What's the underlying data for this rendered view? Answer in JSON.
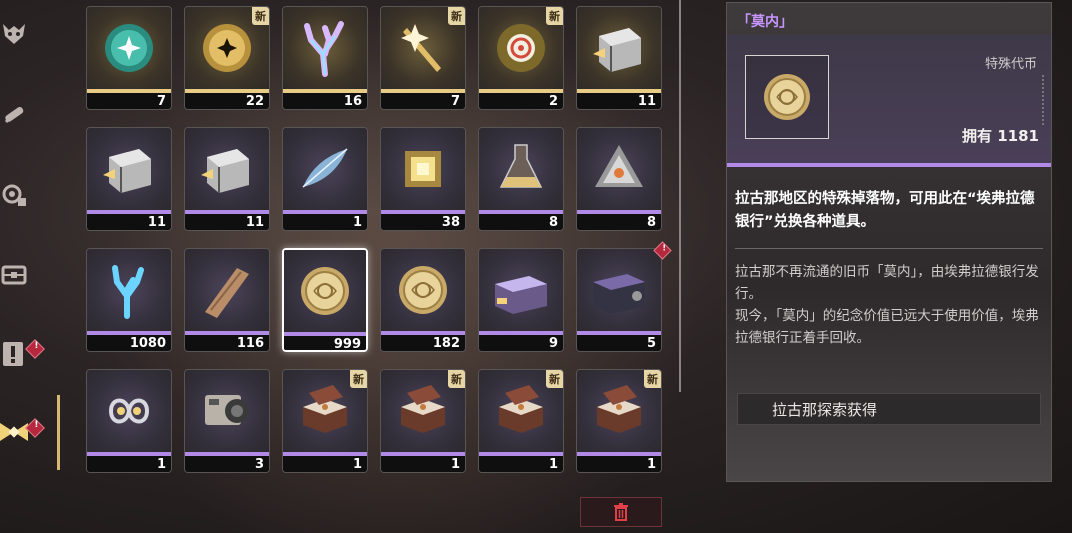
{
  "colors": {
    "gold": "#e8cb85",
    "purple": "#b18ae8",
    "alert": "#b5283d",
    "active": "#d7b871"
  },
  "nav": [
    {
      "icon": "demon-mask-icon"
    },
    {
      "icon": "syringe-icon"
    },
    {
      "icon": "gear-module-icon"
    },
    {
      "icon": "toolbox-icon"
    },
    {
      "icon": "exclamation-card-icon",
      "badge": true
    },
    {
      "icon": "material-cube-icon",
      "badge": true,
      "active": true
    }
  ],
  "items": [
    {
      "qty": "7",
      "rarity": "gold",
      "icon": "teal-orb-icon",
      "new": false
    },
    {
      "qty": "22",
      "rarity": "gold",
      "icon": "gold-orb-icon",
      "new": true
    },
    {
      "qty": "16",
      "rarity": "gold",
      "icon": "crystal-coral-icon",
      "new": false
    },
    {
      "qty": "7",
      "rarity": "gold",
      "icon": "gold-shard-icon",
      "new": true
    },
    {
      "qty": "2",
      "rarity": "gold",
      "icon": "target-orb-icon",
      "new": true
    },
    {
      "qty": "11",
      "rarity": "gold",
      "icon": "steel-crate-icon",
      "new": false
    },
    {
      "qty": "11",
      "rarity": "purple",
      "icon": "steel-crate-icon",
      "new": false
    },
    {
      "qty": "11",
      "rarity": "purple",
      "icon": "steel-crate-icon",
      "new": false
    },
    {
      "qty": "1",
      "rarity": "purple",
      "icon": "crystal-leaf-icon",
      "new": false
    },
    {
      "qty": "38",
      "rarity": "purple",
      "icon": "glowing-cube-icon",
      "new": false
    },
    {
      "qty": "8",
      "rarity": "purple",
      "icon": "flask-icon",
      "new": false
    },
    {
      "qty": "8",
      "rarity": "purple",
      "icon": "triangle-device-icon",
      "new": false
    },
    {
      "qty": "1080",
      "rarity": "purple",
      "icon": "blue-coral-icon",
      "new": false
    },
    {
      "qty": "116",
      "rarity": "purple",
      "icon": "wood-plank-icon",
      "new": false
    },
    {
      "qty": "999",
      "rarity": "purple",
      "icon": "gold-coin-icon",
      "new": false,
      "selected": true
    },
    {
      "qty": "182",
      "rarity": "purple",
      "icon": "gold-coin-icon",
      "new": false
    },
    {
      "qty": "9",
      "rarity": "purple",
      "icon": "purple-chest-icon",
      "new": false
    },
    {
      "qty": "5",
      "rarity": "purple",
      "icon": "dark-chest-icon",
      "new": false,
      "alert": true
    },
    {
      "qty": "1",
      "rarity": "purple",
      "icon": "infinity-charm-icon",
      "new": false
    },
    {
      "qty": "3",
      "rarity": "purple",
      "icon": "camera-icon",
      "new": false
    },
    {
      "qty": "1",
      "rarity": "purple",
      "icon": "jewel-box-icon",
      "new": true
    },
    {
      "qty": "1",
      "rarity": "purple",
      "icon": "jewel-box-icon",
      "new": true
    },
    {
      "qty": "1",
      "rarity": "purple",
      "icon": "jewel-box-icon",
      "new": true
    },
    {
      "qty": "1",
      "rarity": "purple",
      "icon": "jewel-box-icon",
      "new": true
    }
  ],
  "new_label": "新",
  "detail": {
    "title": "「莫内」",
    "type": "特殊代币",
    "own": "拥有 1181",
    "desc_main": "拉古那地区的特殊掉落物，可用此在“埃弗拉德银行”兑换各种道具。",
    "desc_sub_1": "拉古那不再流通的旧币「莫内」，由埃弗拉德银行发行。",
    "desc_sub_2": "现今，「莫内」的纪念价值已远大于使用价值，埃弗拉德银行正着手回收。",
    "source": "拉古那探索获得"
  }
}
